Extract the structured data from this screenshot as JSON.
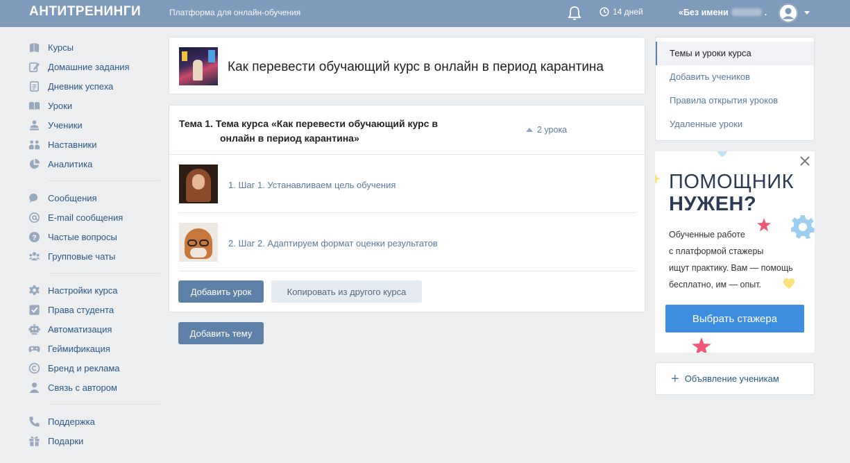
{
  "header": {
    "logo": "АНТИТРЕНИНГИ",
    "slogan": "Платформа для онлайн-обучения",
    "trial": "14 дней",
    "user_name": "«Без имени",
    "user_suffix": "."
  },
  "sidebar": {
    "group1": [
      {
        "label": "Курсы",
        "icon": "courses-icon"
      },
      {
        "label": "Домашние задания",
        "icon": "homework-icon"
      },
      {
        "label": "Дневник успеха",
        "icon": "diary-icon"
      },
      {
        "label": "Уроки",
        "icon": "lessons-icon"
      },
      {
        "label": "Ученики",
        "icon": "students-icon"
      },
      {
        "label": "Наставники",
        "icon": "mentors-icon"
      },
      {
        "label": "Аналитика",
        "icon": "analytics-icon"
      }
    ],
    "group2": [
      {
        "label": "Сообщения",
        "icon": "messages-icon"
      },
      {
        "label": "E-mail сообщения",
        "icon": "email-icon"
      },
      {
        "label": "Частые вопросы",
        "icon": "faq-icon"
      },
      {
        "label": "Групповые чаты",
        "icon": "group-chat-icon"
      }
    ],
    "group3": [
      {
        "label": "Настройки курса",
        "icon": "settings-icon"
      },
      {
        "label": "Права студента",
        "icon": "rights-icon"
      },
      {
        "label": "Автоматизация",
        "icon": "robot-icon"
      },
      {
        "label": "Геймификация",
        "icon": "gamepad-icon"
      },
      {
        "label": "Бренд и реклама",
        "icon": "copyright-icon"
      },
      {
        "label": "Связь с автором",
        "icon": "author-icon"
      }
    ],
    "group4": [
      {
        "label": "Поддержка",
        "icon": "phone-icon"
      },
      {
        "label": "Подарки",
        "icon": "gift-icon"
      }
    ]
  },
  "course": {
    "title": "Как перевести обучающий курс в онлайн в период карантина"
  },
  "topic": {
    "title_line1": "Тема 1. Тема курса «Как перевести обучающий курс в",
    "title_line2": "онлайн в период карантина»",
    "lessons_count": "2 урока",
    "lessons": [
      {
        "label": "1. Шаг 1. Устанавливаем цель обучения"
      },
      {
        "label": "2. Шаг 2. Адаптируем формат оценки результатов"
      }
    ],
    "add_lesson": "Добавить урок",
    "copy_from": "Копировать из другого курса"
  },
  "add_topic": "Добавить тему",
  "right_menu": [
    {
      "label": "Темы и уроки курса",
      "active": true
    },
    {
      "label": "Добавить учеников",
      "active": false
    },
    {
      "label": "Правила открытия уроков",
      "active": false
    },
    {
      "label": "Удаленные уроки",
      "active": false
    }
  ],
  "promo": {
    "title_line1": "ПОМОЩНИК",
    "title_line2": "НУЖЕН?",
    "text": "Обученные работе с платформой стажеры ищут практику. Вам — помощь бесплатно, им — опыт.",
    "text_lines": [
      "Обученные работе",
      "с платформой стажеры",
      "ищут практику. Вам — помощь",
      "бесплатно, им — опыт."
    ],
    "button": "Выбрать стажера"
  },
  "announce": "Объявление ученикам",
  "colors": {
    "header": "#7f9bbb",
    "link": "#2a5885",
    "button": "#5e81a8",
    "promo_button": "#3d8ee0"
  }
}
